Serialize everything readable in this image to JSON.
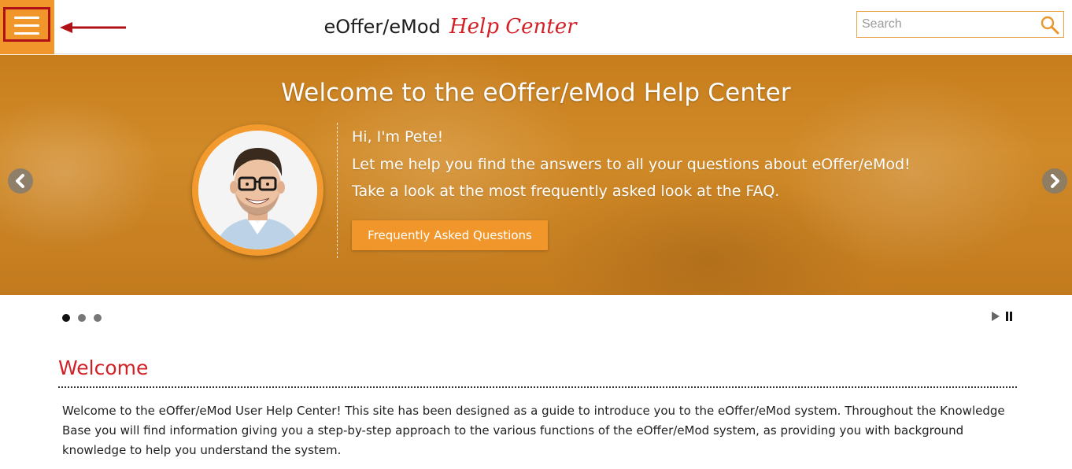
{
  "header": {
    "title_main": "eOffer/eMod",
    "title_accent": "Help Center",
    "menu_icon": "hamburger-menu-icon",
    "annotation_icon": "red-arrow-icon",
    "search": {
      "placeholder": "Search",
      "value": "",
      "icon": "magnifier-icon"
    }
  },
  "hero": {
    "title": "Welcome to the eOffer/eMod Help Center",
    "lines": [
      "Hi, I'm Pete!",
      "Let me help you find the answers to all your questions about eOffer/eMod!",
      "Take a look at the most frequently asked look at the FAQ."
    ],
    "button_label": "Frequently Asked Questions",
    "prev_icon": "chevron-left-icon",
    "next_icon": "chevron-right-icon"
  },
  "carousel": {
    "slide_count": 3,
    "active_index": 0,
    "play_icon": "play-icon",
    "pause_icon": "pause-icon"
  },
  "welcome": {
    "heading": "Welcome",
    "body": "Welcome to the eOffer/eMod User Help Center! This site has been designed as a guide to introduce you to the eOffer/eMod system. Throughout the Knowledge Base you will find information giving you a step-by-step approach to the various functions of the eOffer/eMod system, as providing you with background knowledge to help you understand the system."
  },
  "colors": {
    "accent_orange": "#f0962a",
    "title_red": "#d32027",
    "highlight_red": "#b01116"
  }
}
